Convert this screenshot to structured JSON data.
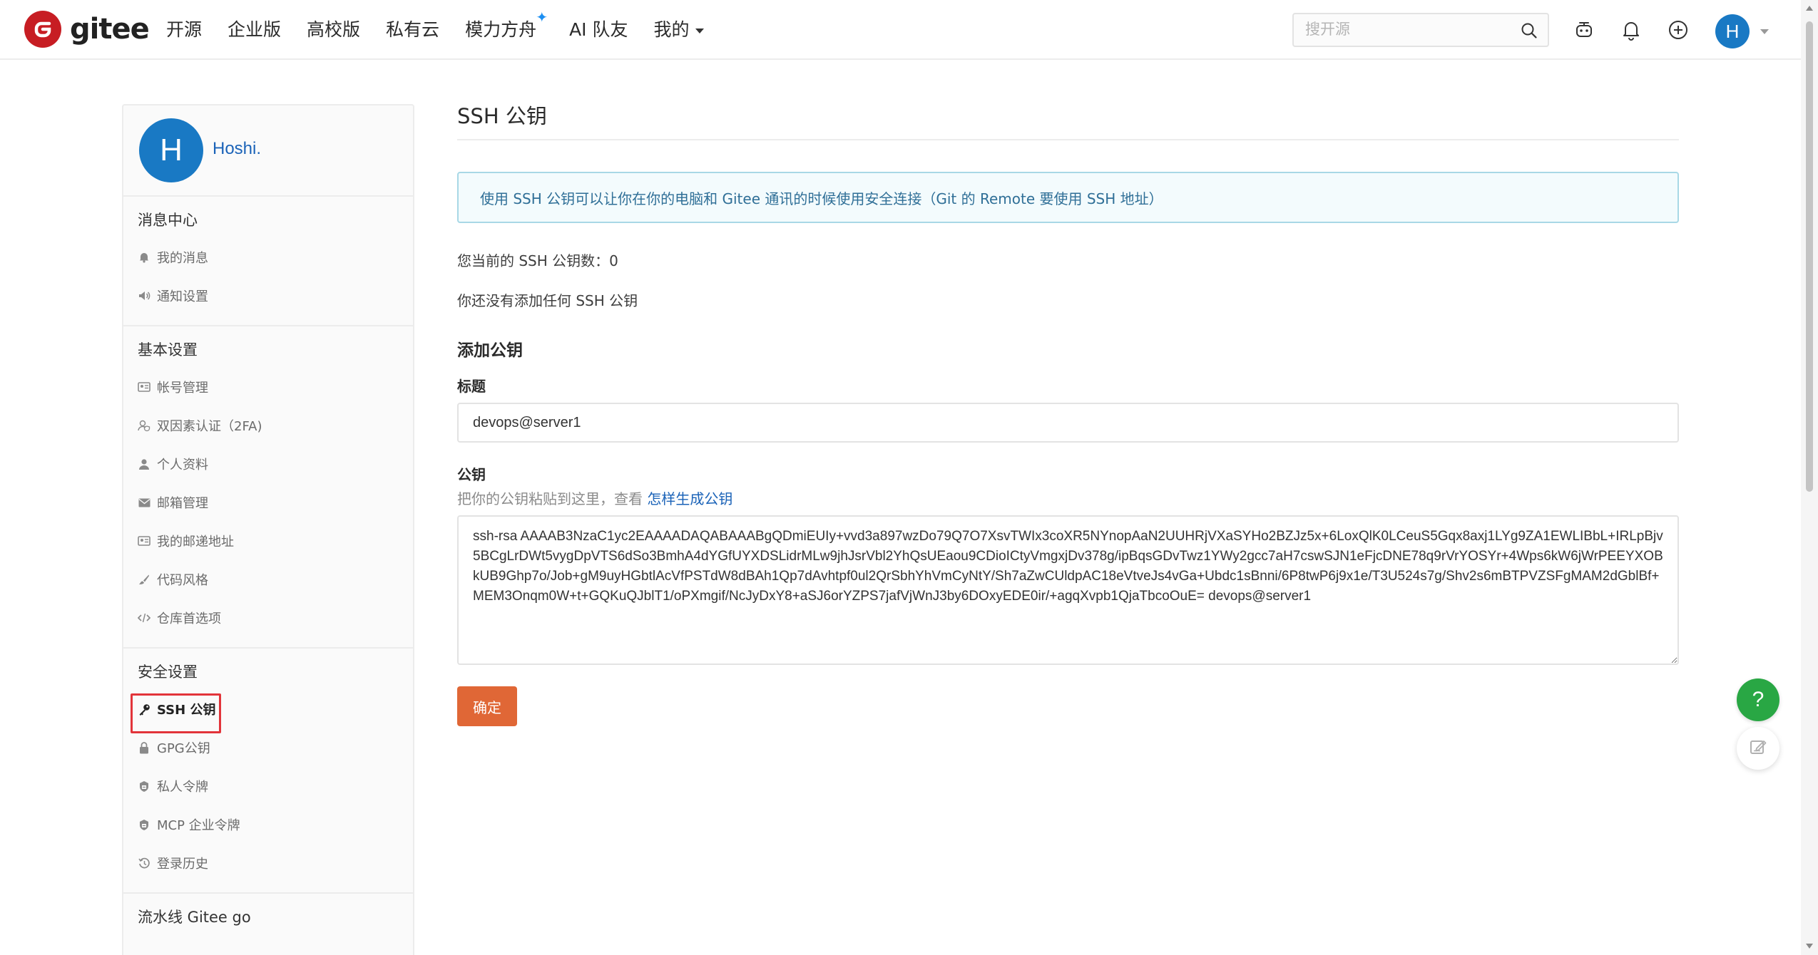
{
  "header": {
    "brand": "gitee",
    "nav": [
      {
        "label": "开源"
      },
      {
        "label": "企业版"
      },
      {
        "label": "高校版"
      },
      {
        "label": "私有云"
      },
      {
        "label": "模力方舟"
      },
      {
        "label": "AI 队友"
      },
      {
        "label": "我的"
      }
    ],
    "search_placeholder": "搜开源",
    "avatar_letter": "H"
  },
  "sidebar": {
    "user": {
      "initial": "H",
      "name": "Hoshi."
    },
    "sections": [
      {
        "title": "消息中心",
        "items": [
          {
            "label": "我的消息",
            "icon": "bell-icon"
          },
          {
            "label": "通知设置",
            "icon": "speaker-icon"
          }
        ]
      },
      {
        "title": "基本设置",
        "items": [
          {
            "label": "帐号管理",
            "icon": "id-card-icon"
          },
          {
            "label": "双因素认证（2FA)",
            "icon": "user-shield-icon"
          },
          {
            "label": "个人资料",
            "icon": "user-icon"
          },
          {
            "label": "邮箱管理",
            "icon": "envelope-icon"
          },
          {
            "label": "我的邮递地址",
            "icon": "address-card-icon"
          },
          {
            "label": "代码风格",
            "icon": "brush-icon"
          },
          {
            "label": "仓库首选项",
            "icon": "code-icon"
          }
        ]
      },
      {
        "title": "安全设置",
        "items": [
          {
            "label": "SSH 公钥",
            "icon": "key-icon",
            "active": true
          },
          {
            "label": "GPG公钥",
            "icon": "lock-icon"
          },
          {
            "label": "私人令牌",
            "icon": "token-icon"
          },
          {
            "label": "MCP 企业令牌",
            "icon": "token-icon"
          },
          {
            "label": "登录历史",
            "icon": "history-icon"
          }
        ]
      },
      {
        "title": "流水线 Gitee go",
        "items": []
      }
    ]
  },
  "main": {
    "title": "SSH 公钥",
    "info": "使用 SSH 公钥可以让你在你的电脑和 Gitee 通讯的时候使用安全连接（Git 的 Remote 要使用 SSH 地址）",
    "count_text": "您当前的 SSH 公钥数：",
    "count_value": "0",
    "empty_text": "你还没有添加任何 SSH 公钥",
    "add_title": "添加公钥",
    "title_label": "标题",
    "title_value": "devops@server1",
    "key_label": "公钥",
    "key_hint": "把你的公钥粘贴到这里，查看 ",
    "key_hint_link": "怎样生成公钥",
    "key_value": "ssh-rsa AAAAB3NzaC1yc2EAAAADAQABAAABgQDmiEUIy+vvd3a897wzDo79Q7O7XsvTWIx3coXR5NYnopAaN2UUHRjVXaSYHo2BZJz5x+6LoxQlK0LCeuS5Gqx8axj1LYg9ZA1EWLIBbL+IRLpBjv5BCgLrDWt5vygDpVTS6dSo3BmhA4dYGfUYXDSLidrMLw9jhJsrVbl2YhQsUEaou9CDioICtyVmgxjDv378g/ipBqsGDvTwz1YWy2gcc7aH7cswSJN1eFjcDNE78q9rVrYOSYr+4Wps6kW6jWrPEEYXOBkUB9Ghp7o/Job+gM9uyHGbtlAcVfPSTdW8dBAh1Qp7dAvhtpf0ul2QrSbhYhVmCyNtY/Sh7aZwCUldpAC18eVtveJs4vGa+Ubdc1sBnni/6P8twP6j9x1e/T3U524s7g/Shv2s6mBTPVZSFgMAM2dGblBf+MEM3Onqm0W+t+GQKuQJblT1/oPXmgif/NcJyDxY8+aSJ6orYZPS7jafVjWnJ3by6DOxyEDE0ir/+agqXvpb1QjaTbcoOuE= devops@server1",
    "submit_label": "确定"
  },
  "float": {
    "help_label": "?"
  },
  "colors": {
    "brand_red": "#c71d23",
    "accent_orange": "#e06736",
    "link_blue": "#1b63b8",
    "help_green": "#29a744",
    "highlight_red": "#e2343a"
  }
}
